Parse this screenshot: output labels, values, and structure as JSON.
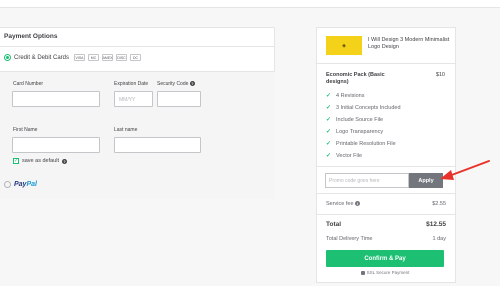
{
  "payment": {
    "title": "Payment Options",
    "credit_label": "Credit & Debit Cards",
    "cards": [
      "VISA",
      "MC",
      "AMEX",
      "DISC",
      "DC"
    ],
    "card_number_label": "Card Number",
    "expiration_label": "Expiration Date",
    "expiration_placeholder": "MM/YY",
    "security_label": "Security Code",
    "first_name_label": "First Name",
    "last_name_label": "Last name",
    "save_default_label": "save as default",
    "paypal_part1": "Pay",
    "paypal_part2": "Pal"
  },
  "order": {
    "gig_title": "I Will Design 3 Modern Minimalist Logo Design",
    "package_name": "Economic Pack (Basic designs)",
    "package_price": "$10",
    "features": [
      "4 Revisions",
      "3 Initial Concepts Included",
      "Include Source File",
      "Logo Transparency",
      "Printable Resolution File",
      "Vector File"
    ],
    "promo_placeholder": "Promo code goes here",
    "apply_label": "Apply",
    "service_fee_label": "Service fee",
    "service_fee_value": "$2.55",
    "total_label": "Total",
    "total_value": "$12.55",
    "delivery_label": "Total Delivery Time",
    "delivery_value": "1 day",
    "confirm_label": "Confirm & Pay",
    "secure_label": "SSL Secure Payment"
  },
  "colors": {
    "accent": "#1dbf73",
    "apply_bg": "#74767e",
    "arrow": "#e8332a",
    "thumb": "#f4d21a"
  }
}
